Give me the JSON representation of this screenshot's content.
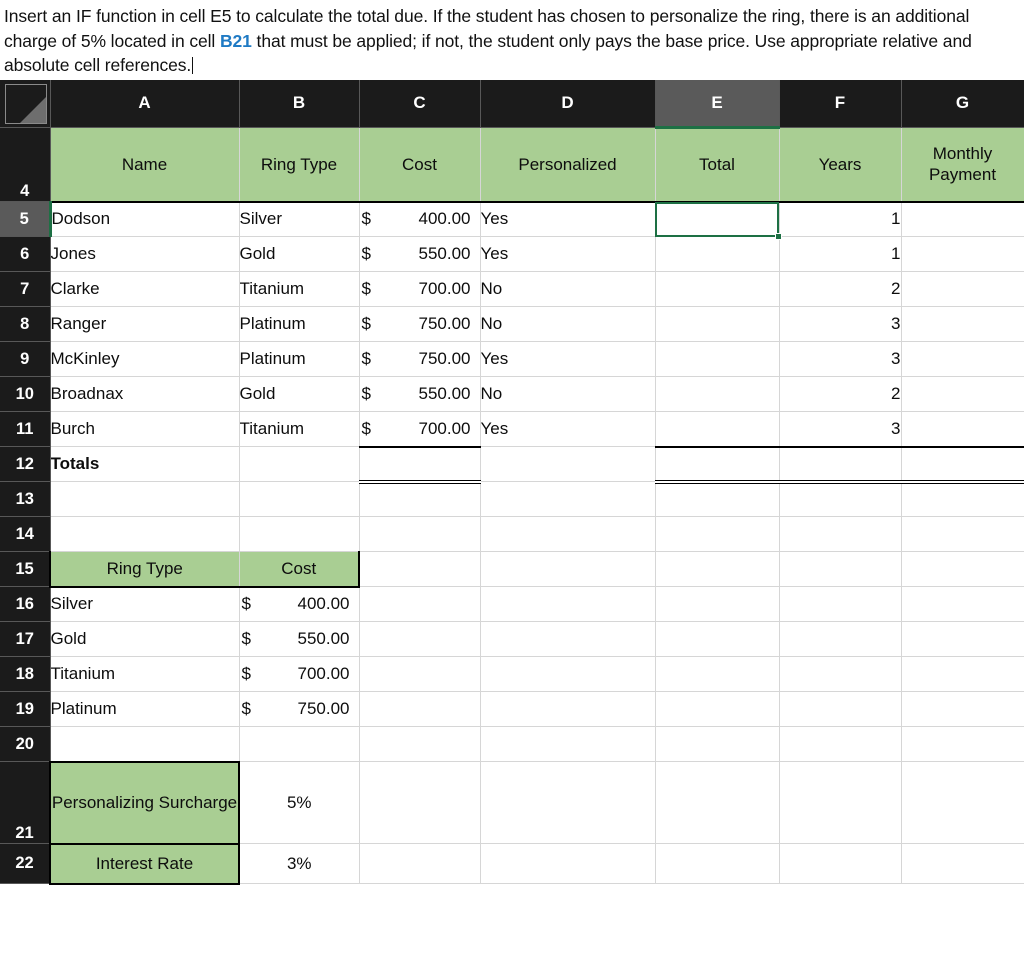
{
  "prompt": {
    "part1": "Insert an IF function in cell E5 to calculate the total due. If the student has chosen to personalize the ring, there is an additional charge of 5% located in cell ",
    "ref": "B21",
    "part2": " that must be applied; if not, the student only pays the base price. Use appropriate relative and absolute cell references."
  },
  "colors": {
    "header_green": "#a9ce93",
    "selection_green": "#1d7044",
    "gutter_dark": "#1b1b1b",
    "gutter_selected": "#5a5a5a",
    "link_blue": "#1f7ac4"
  },
  "grid": {
    "column_letters": [
      "A",
      "B",
      "C",
      "D",
      "E",
      "F",
      "G"
    ],
    "selected_column": "E",
    "selected_row": "5",
    "selected_cell": "E5",
    "row_numbers": [
      "4",
      "5",
      "6",
      "7",
      "8",
      "9",
      "10",
      "11",
      "12",
      "13",
      "14",
      "15",
      "16",
      "17",
      "18",
      "19",
      "20",
      "21",
      "22"
    ]
  },
  "table_headers": {
    "name": "Name",
    "ring_type": "Ring Type",
    "cost": "Cost",
    "personalized": "Personalized",
    "total": "Total",
    "years": "Years",
    "monthly_payment": "Monthly Payment"
  },
  "rows": [
    {
      "row": "5",
      "name": "Dodson",
      "ring_type": "Silver",
      "cost_symbol": "$",
      "cost": "400.00",
      "personalized": "Yes",
      "total": "",
      "years": "1",
      "monthly": ""
    },
    {
      "row": "6",
      "name": "Jones",
      "ring_type": "Gold",
      "cost_symbol": "$",
      "cost": "550.00",
      "personalized": "Yes",
      "total": "",
      "years": "1",
      "monthly": ""
    },
    {
      "row": "7",
      "name": "Clarke",
      "ring_type": "Titanium",
      "cost_symbol": "$",
      "cost": "700.00",
      "personalized": "No",
      "total": "",
      "years": "2",
      "monthly": ""
    },
    {
      "row": "8",
      "name": "Ranger",
      "ring_type": "Platinum",
      "cost_symbol": "$",
      "cost": "750.00",
      "personalized": "No",
      "total": "",
      "years": "3",
      "monthly": ""
    },
    {
      "row": "9",
      "name": "McKinley",
      "ring_type": "Platinum",
      "cost_symbol": "$",
      "cost": "750.00",
      "personalized": "Yes",
      "total": "",
      "years": "3",
      "monthly": ""
    },
    {
      "row": "10",
      "name": "Broadnax",
      "ring_type": "Gold",
      "cost_symbol": "$",
      "cost": "550.00",
      "personalized": "No",
      "total": "",
      "years": "2",
      "monthly": ""
    },
    {
      "row": "11",
      "name": "Burch",
      "ring_type": "Titanium",
      "cost_symbol": "$",
      "cost": "700.00",
      "personalized": "Yes",
      "total": "",
      "years": "3",
      "monthly": ""
    }
  ],
  "totals_row": {
    "row": "12",
    "label": "Totals",
    "cost": "",
    "total": "",
    "years": "",
    "monthly": ""
  },
  "blank_rows": [
    "13",
    "14"
  ],
  "lookup": {
    "header_row": "15",
    "header_ring_type": "Ring Type",
    "header_cost": "Cost",
    "items": [
      {
        "row": "16",
        "ring_type": "Silver",
        "cost_symbol": "$",
        "cost": "400.00"
      },
      {
        "row": "17",
        "ring_type": "Gold",
        "cost_symbol": "$",
        "cost": "550.00"
      },
      {
        "row": "18",
        "ring_type": "Titanium",
        "cost_symbol": "$",
        "cost": "700.00"
      },
      {
        "row": "19",
        "ring_type": "Platinum",
        "cost_symbol": "$",
        "cost": "750.00"
      }
    ],
    "blank_row": "20"
  },
  "rates": [
    {
      "row": "21",
      "label": "Personalizing Surcharge",
      "value": "5%"
    },
    {
      "row": "22",
      "label": "Interest Rate",
      "value": "3%"
    }
  ]
}
